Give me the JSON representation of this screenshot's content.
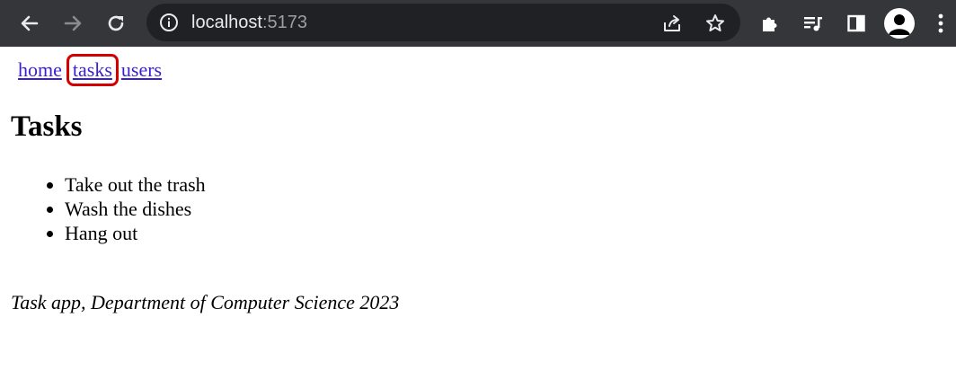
{
  "browser": {
    "url_host": "localhost",
    "url_port": ":5173",
    "icons": [
      "back-arrow-icon",
      "forward-arrow-icon",
      "reload-icon",
      "info-icon",
      "share-icon",
      "star-icon",
      "extensions-puzzle-icon",
      "media-queue-icon",
      "side-panel-icon",
      "profile-avatar-icon",
      "kebab-menu-icon"
    ]
  },
  "nav": {
    "home": "home",
    "tasks": "tasks",
    "users": "users",
    "active": "tasks"
  },
  "main": {
    "title": "Tasks",
    "tasks": [
      "Take out the trash",
      "Wash the dishes",
      "Hang out"
    ]
  },
  "footer": {
    "text": "Task app, Department of Computer Science 2023"
  },
  "colors": {
    "toolbar": "#35363a",
    "omnibox": "#202124",
    "link": "#3a1fd0",
    "highlight": "#d40000"
  }
}
